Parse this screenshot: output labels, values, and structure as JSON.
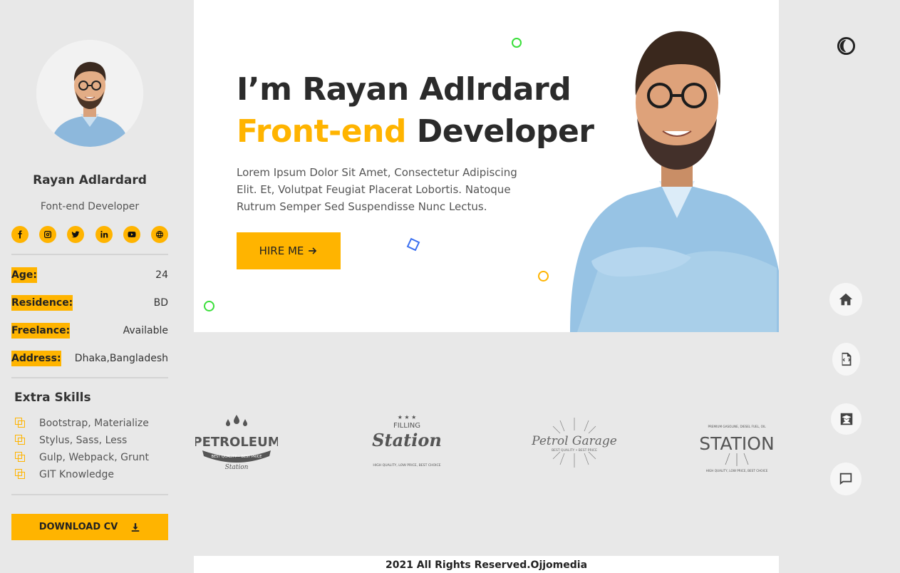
{
  "profile": {
    "name": "Rayan Adlardard",
    "role": "Font-end Developer"
  },
  "socials": [
    {
      "icon": "facebook-icon"
    },
    {
      "icon": "instagram-icon"
    },
    {
      "icon": "twitter-icon"
    },
    {
      "icon": "linkedin-icon"
    },
    {
      "icon": "youtube-icon"
    },
    {
      "icon": "globe-icon"
    }
  ],
  "info": [
    {
      "label": "Age:",
      "value": "24"
    },
    {
      "label": "Residence:",
      "value": "BD"
    },
    {
      "label": "Freelance:",
      "value": "Available"
    },
    {
      "label": "Address:",
      "value": "Dhaka,Bangladesh"
    }
  ],
  "skills": {
    "title": "Extra Skills",
    "items": [
      "Bootstrap, Materialize",
      "Stylus, Sass, Less",
      "Gulp, Webpack, Grunt",
      "GIT Knowledge"
    ]
  },
  "download_cv": "DOWNLOAD CV",
  "hero": {
    "title_line1": "I’m Rayan Adlrdard",
    "title_accent": "Front-end",
    "title_rest": " Developer",
    "description": "Lorem Ipsum Dolor Sit Amet, Consectetur Adipiscing Elit. Et, Volutpat Feugiat Placerat Lobortis. Natoque Rutrum Semper Sed Suspendisse Nunc Lectus.",
    "hire_label": "HIRE ME"
  },
  "brands": [
    {
      "main": "PETROLEUM",
      "sub": "BEST QUALITY • BEST PRICE",
      "tag": "Station"
    },
    {
      "main": "Station",
      "sub": "FILLING",
      "tag": "HIGH QUALITY, LOW PRICE, BEST CHOICE"
    },
    {
      "main": "Petrol Garage",
      "sub": "BEST QUALITY • BEST PRICE"
    },
    {
      "main": "STATION",
      "sub": "PREMIUM GASOLINE, DIESEL FUEL, OIL",
      "tag": "HIGH QUALITY, LOW PRICE, BEST CHOICE"
    }
  ],
  "footer": "2021 All Rights Reserved.Ojjomedia",
  "nav": [
    {
      "icon": "home-icon"
    },
    {
      "icon": "code-file-icon"
    },
    {
      "icon": "graduate-icon"
    },
    {
      "icon": "chat-icon"
    }
  ],
  "colors": {
    "accent": "#ffb400",
    "background": "#e8e8e8",
    "panel": "#ffffff"
  }
}
